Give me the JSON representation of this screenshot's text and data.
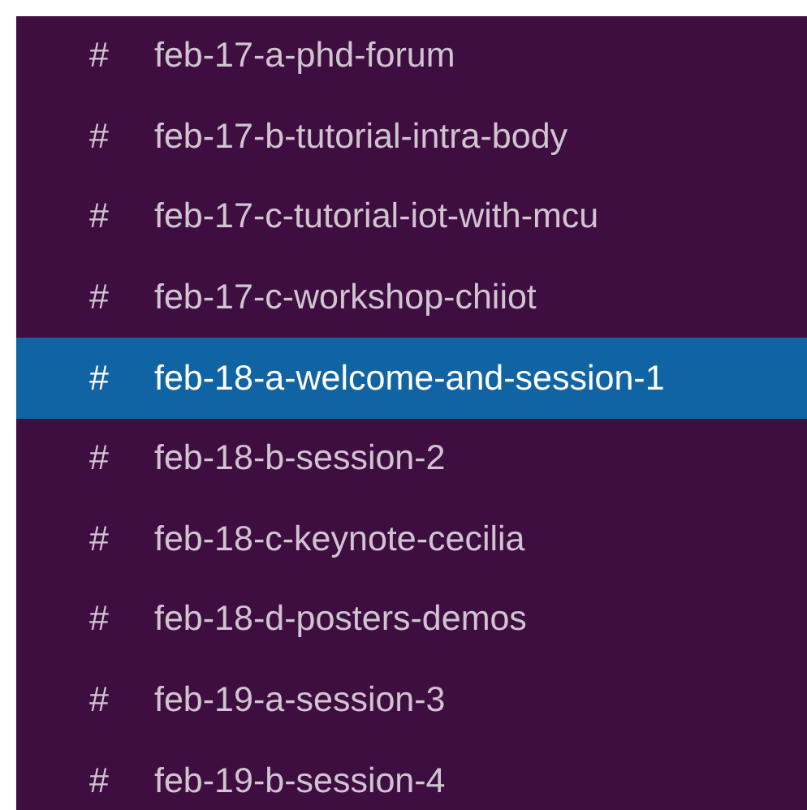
{
  "channels": [
    {
      "icon": "#",
      "name": "feb-17-a-phd-forum",
      "selected": false
    },
    {
      "icon": "#",
      "name": "feb-17-b-tutorial-intra-body",
      "selected": false
    },
    {
      "icon": "#",
      "name": "feb-17-c-tutorial-iot-with-mcu",
      "selected": false
    },
    {
      "icon": "#",
      "name": "feb-17-c-workshop-chiiot",
      "selected": false
    },
    {
      "icon": "#",
      "name": "feb-18-a-welcome-and-session-1",
      "selected": true
    },
    {
      "icon": "#",
      "name": "feb-18-b-session-2",
      "selected": false
    },
    {
      "icon": "#",
      "name": "feb-18-c-keynote-cecilia",
      "selected": false
    },
    {
      "icon": "#",
      "name": "feb-18-d-posters-demos",
      "selected": false
    },
    {
      "icon": "#",
      "name": "feb-19-a-session-3",
      "selected": false
    },
    {
      "icon": "#",
      "name": "feb-19-b-session-4",
      "selected": false
    }
  ]
}
